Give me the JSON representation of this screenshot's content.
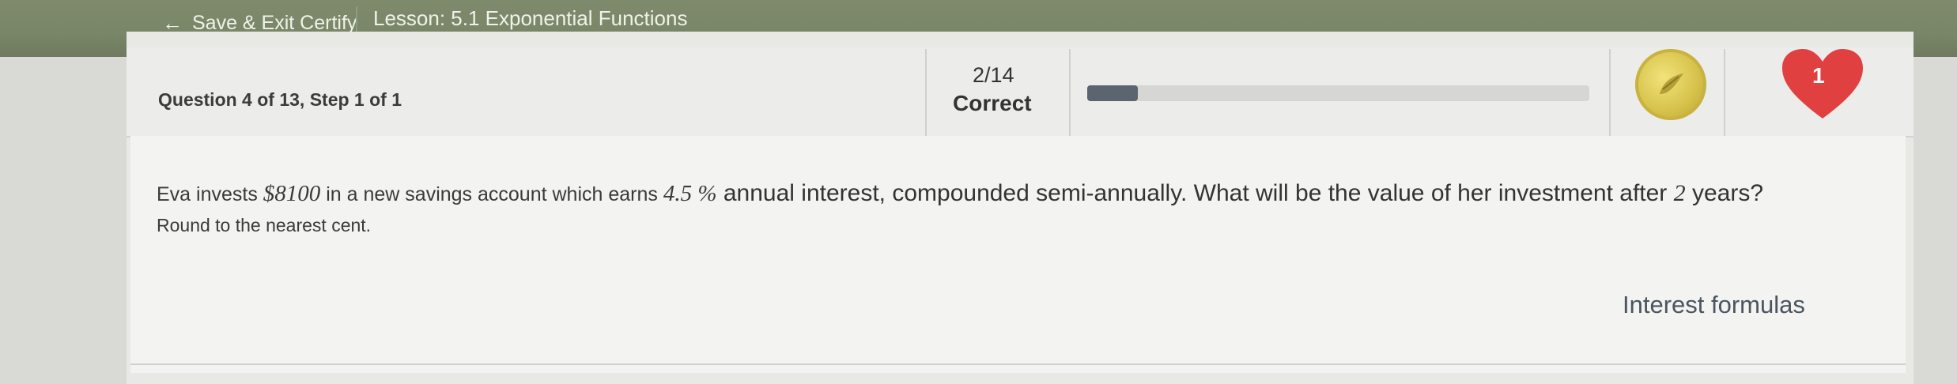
{
  "header": {
    "back_arrow": "←",
    "back_label": "Save & Exit Certify",
    "lesson_title": "Lesson: 5.1 Exponential Functions"
  },
  "question_bar": {
    "position_label": "Question 4 of 13, Step 1 of 1",
    "score_fraction": "2/14",
    "score_label": "Correct",
    "progress_fraction": 0.1,
    "lives": "1"
  },
  "question": {
    "text_before_amount": "Eva invests ",
    "amount": "$8100",
    "text_before_rate": " in a new savings account which earns ",
    "rate": "4.5 %",
    "text_before_years": " annual interest, compounded semi-annually.  What will be the value of her investment after ",
    "years": "2",
    "text_after_years": " years?",
    "instruction": "Round to the nearest cent.",
    "help_link": "Interest formulas"
  },
  "icons": {
    "back": "arrow-left-icon",
    "coin": "coin-icon",
    "heart": "heart-icon"
  },
  "colors": {
    "topbar": "#7a8668",
    "progress_fill": "#5b6570",
    "heart": "#e04040",
    "coin": "#d6c34c"
  }
}
